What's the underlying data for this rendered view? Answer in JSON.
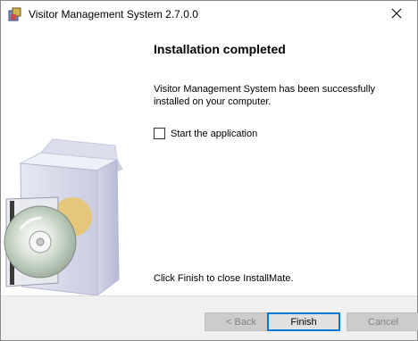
{
  "window": {
    "title": "Visitor Management System 2.7.0.0",
    "app_icon": "installer-icon",
    "close_icon": "close-icon"
  },
  "page": {
    "heading": "Installation completed",
    "message": "Visitor Management System has been successfully installed on your computer.",
    "checkbox_label": "Start the application",
    "checkbox_checked": false,
    "finish_hint": "Click Finish to close InstallMate."
  },
  "illustration": {
    "icon": "software-box-with-cd-illustration"
  },
  "buttons": {
    "back_label": "< Back",
    "finish_label": "Finish",
    "cancel_label": "Cancel"
  },
  "colors": {
    "accent": "#0078d7",
    "footer_bg": "#f0f0f0",
    "disabled_text": "#838383"
  }
}
